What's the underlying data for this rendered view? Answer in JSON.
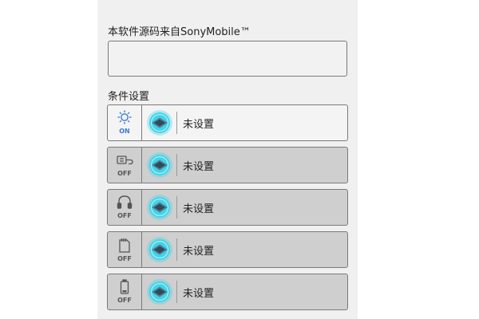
{
  "source": {
    "label": "本软件源码来自SonyMobile™",
    "value": ""
  },
  "conditions": {
    "title": "条件设置",
    "rows": [
      {
        "trigger_icon": "brightness-icon",
        "state": "ON",
        "label": "未设置"
      },
      {
        "trigger_icon": "usb-cable-icon",
        "state": "OFF",
        "label": "未设置"
      },
      {
        "trigger_icon": "headphones-icon",
        "state": "OFF",
        "label": "未设置"
      },
      {
        "trigger_icon": "sd-card-icon",
        "state": "OFF",
        "label": "未设置"
      },
      {
        "trigger_icon": "battery-icon",
        "state": "OFF",
        "label": "未设置"
      }
    ]
  },
  "colors": {
    "on_text": "#3a7bd5",
    "off_text": "#555555",
    "action_glow": "#3fd4e8",
    "action_diamond": "#5b7a8c"
  }
}
